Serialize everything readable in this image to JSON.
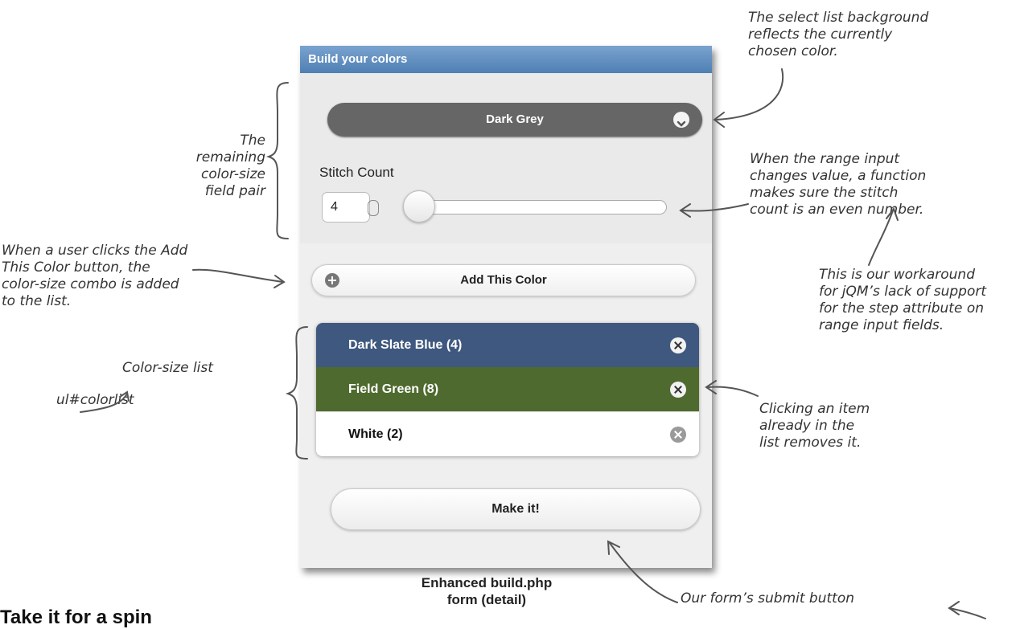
{
  "app": {
    "header_title": "Build your colors",
    "select": {
      "value": "Dark Grey",
      "color": "#666666"
    },
    "stitch": {
      "label": "Stitch Count",
      "value": "4"
    },
    "add_button_label": "Add This Color",
    "color_list": [
      {
        "label": "Dark Slate Blue (4)",
        "bg": "#3f587f",
        "fg": "#ffffff"
      },
      {
        "label": "Field Green (8)",
        "bg": "#4f6a2e",
        "fg": "#ffffff"
      },
      {
        "label": "White (2)",
        "bg": "#ffffff",
        "fg": "#111111"
      }
    ],
    "submit_label": "Make it!"
  },
  "caption": {
    "line1": "Enhanced build.php",
    "line2": "form (detail)"
  },
  "annotations": {
    "select_bg": [
      "The select list background",
      "reflects the currently",
      "chosen color."
    ],
    "remaining_pair": [
      "The remaining",
      "color-size",
      "field pair"
    ],
    "range_change": [
      "When the range input",
      "changes value, a function",
      "makes sure the stitch",
      "count is an even number."
    ],
    "add_click": [
      "When a user clicks the Add",
      "This Color button, the",
      "color-size combo is added",
      "to the list."
    ],
    "workaround": [
      "This is our workaround",
      "for jQM’s lack of support",
      "for the step attribute on",
      "range input fields."
    ],
    "color_size_list": "Color-size list",
    "colorlist_id": "ul#colorlist",
    "remove_item": [
      "Clicking an item",
      "already in the",
      "list removes it."
    ],
    "submit_button": "Our form’s submit button"
  },
  "bottom_title": "Take it for a spin"
}
